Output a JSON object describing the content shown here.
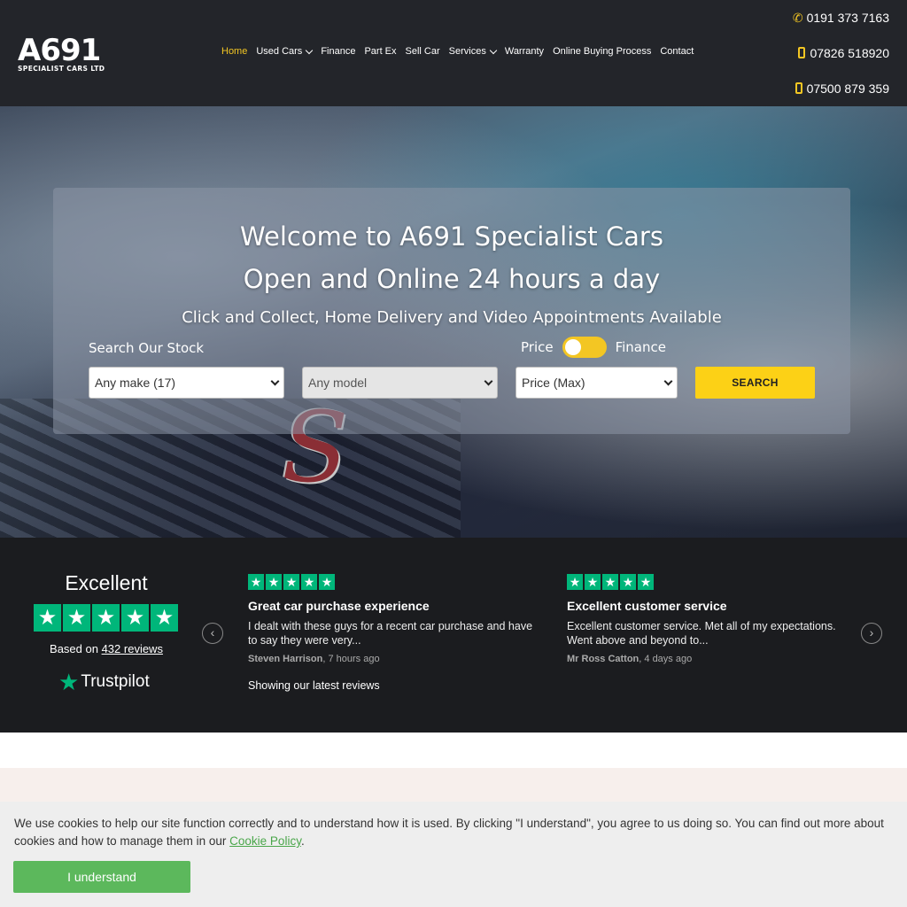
{
  "header": {
    "logo_main": "A691",
    "logo_sub": "SPECIALIST CARS LTD",
    "nav": [
      {
        "label": "Home",
        "active": true
      },
      {
        "label": "Used Cars",
        "dropdown": true
      },
      {
        "label": "Finance"
      },
      {
        "label": "Part Ex"
      },
      {
        "label": "Sell Car"
      },
      {
        "label": "Services",
        "dropdown": true
      },
      {
        "label": "Warranty"
      },
      {
        "label": "Online Buying Process"
      },
      {
        "label": "Contact"
      }
    ],
    "phones": [
      "0191 373 7163",
      "07826 518920",
      "07500 879 359"
    ]
  },
  "hero": {
    "title_line1": "Welcome to A691 Specialist Cars",
    "title_line2": "Open and Online 24 hours a day",
    "subtitle": "Click and Collect, Home Delivery and Video Appointments Available",
    "search_label": "Search Our Stock",
    "toggle_left": "Price",
    "toggle_right": "Finance",
    "make_select": "Any make (17)",
    "model_select": "Any model",
    "price_select": "Price (Max)",
    "search_button": "SEARCH"
  },
  "reviews": {
    "rating_word": "Excellent",
    "based_prefix": "Based on ",
    "based_count": "432 reviews",
    "trustpilot": "Trustpilot",
    "showing": "Showing our latest reviews",
    "items": [
      {
        "title": "Great car purchase experience",
        "body": "I dealt with these guys for a recent car purchase and have to say they were very...",
        "author": "Steven Harrison",
        "time": ", 7 hours ago"
      },
      {
        "title": "Excellent customer service",
        "body": "Excellent customer service. Met all of my expectations. Went above and beyond to...",
        "author": "Mr Ross Catton",
        "time": ", 4 days ago"
      }
    ]
  },
  "cookie": {
    "text": "We use cookies to help our site function correctly and to understand how it is used. By clicking \"I understand\", you agree to us doing so. You can find out more about cookies and how to manage them in our ",
    "link": "Cookie Policy",
    "after": ".",
    "button": "I understand"
  },
  "colors": {
    "accent": "#f3c623",
    "trustpilot_green": "#00b67a",
    "cookie_button": "#5cb85c",
    "header_bg": "#23252a"
  }
}
